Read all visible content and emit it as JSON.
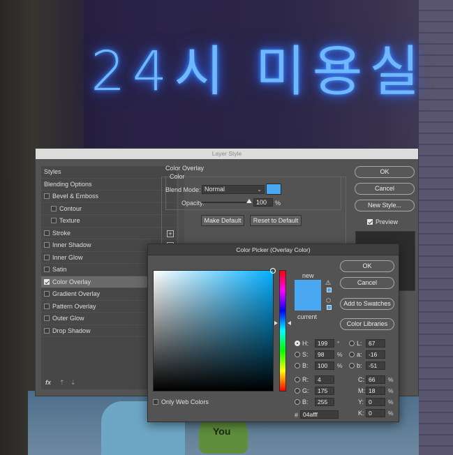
{
  "background": {
    "neon_text": "24시 미용실",
    "heart_text": "You"
  },
  "layer_style": {
    "title": "Layer Style",
    "sidebar": [
      {
        "label": "Styles",
        "checkbox": false,
        "indent": false,
        "plus": false,
        "active": false,
        "checked": false
      },
      {
        "label": "Blending Options",
        "checkbox": false,
        "indent": false,
        "plus": false,
        "active": false,
        "checked": false
      },
      {
        "label": "Bevel & Emboss",
        "checkbox": true,
        "indent": false,
        "plus": false,
        "active": false,
        "checked": false
      },
      {
        "label": "Contour",
        "checkbox": true,
        "indent": true,
        "plus": false,
        "active": false,
        "checked": false
      },
      {
        "label": "Texture",
        "checkbox": true,
        "indent": true,
        "plus": false,
        "active": false,
        "checked": false
      },
      {
        "label": "Stroke",
        "checkbox": true,
        "indent": false,
        "plus": true,
        "active": false,
        "checked": false
      },
      {
        "label": "Inner Shadow",
        "checkbox": true,
        "indent": false,
        "plus": true,
        "active": false,
        "checked": false
      },
      {
        "label": "Inner Glow",
        "checkbox": true,
        "indent": false,
        "plus": false,
        "active": false,
        "checked": false
      },
      {
        "label": "Satin",
        "checkbox": true,
        "indent": false,
        "plus": false,
        "active": false,
        "checked": false
      },
      {
        "label": "Color Overlay",
        "checkbox": true,
        "indent": false,
        "plus": true,
        "active": true,
        "checked": true
      },
      {
        "label": "Gradient Overlay",
        "checkbox": true,
        "indent": false,
        "plus": true,
        "active": false,
        "checked": false
      },
      {
        "label": "Pattern Overlay",
        "checkbox": true,
        "indent": false,
        "plus": false,
        "active": false,
        "checked": false
      },
      {
        "label": "Outer Glow",
        "checkbox": true,
        "indent": false,
        "plus": false,
        "active": false,
        "checked": false
      },
      {
        "label": "Drop Shadow",
        "checkbox": true,
        "indent": false,
        "plus": true,
        "active": false,
        "checked": false
      }
    ],
    "bottom_icons": {
      "fx": "fx",
      "up": "⇡",
      "down": "⇣",
      "trash": "🗑"
    },
    "panel": {
      "group_title": "Color Overlay",
      "sub_title": "Color",
      "blend_mode_label": "Blend Mode:",
      "blend_mode_value": "Normal",
      "overlay_color": "#4aa7f2",
      "opacity_label": "Opacity:",
      "opacity_value": "100",
      "opacity_unit": "%",
      "opacity_level": 1.0,
      "make_default": "Make Default",
      "reset_default": "Reset to Default"
    },
    "buttons": {
      "ok": "OK",
      "cancel": "Cancel",
      "new_style": "New Style...",
      "preview": "Preview"
    }
  },
  "color_picker": {
    "title": "Color Picker (Overlay Color)",
    "new_label": "new",
    "current_label": "current",
    "new_color": "#4aa7f2",
    "current_color": "#4aa7f2",
    "buttons": {
      "ok": "OK",
      "cancel": "Cancel",
      "add_swatches": "Add to Swatches",
      "color_libraries": "Color Libraries"
    },
    "fields_left": [
      {
        "label": "H:",
        "value": "199",
        "unit": "°",
        "selected": true
      },
      {
        "label": "S:",
        "value": "98",
        "unit": "%",
        "selected": false
      },
      {
        "label": "B:",
        "value": "100",
        "unit": "%",
        "selected": false
      },
      {
        "label": "R:",
        "value": "4",
        "unit": "",
        "selected": false
      },
      {
        "label": "G:",
        "value": "175",
        "unit": "",
        "selected": false
      },
      {
        "label": "B:",
        "value": "255",
        "unit": "",
        "selected": false
      }
    ],
    "fields_right": [
      {
        "label": "L:",
        "value": "67",
        "unit": ""
      },
      {
        "label": "a:",
        "value": "-16",
        "unit": ""
      },
      {
        "label": "b:",
        "value": "-51",
        "unit": ""
      },
      {
        "label": "C:",
        "value": "66",
        "unit": "%"
      },
      {
        "label": "M:",
        "value": "18",
        "unit": "%"
      },
      {
        "label": "Y:",
        "value": "0",
        "unit": "%"
      },
      {
        "label": "K:",
        "value": "0",
        "unit": "%"
      }
    ],
    "hex_label": "#",
    "hex_value": "04afff",
    "only_web_colors": "Only Web Colors"
  }
}
